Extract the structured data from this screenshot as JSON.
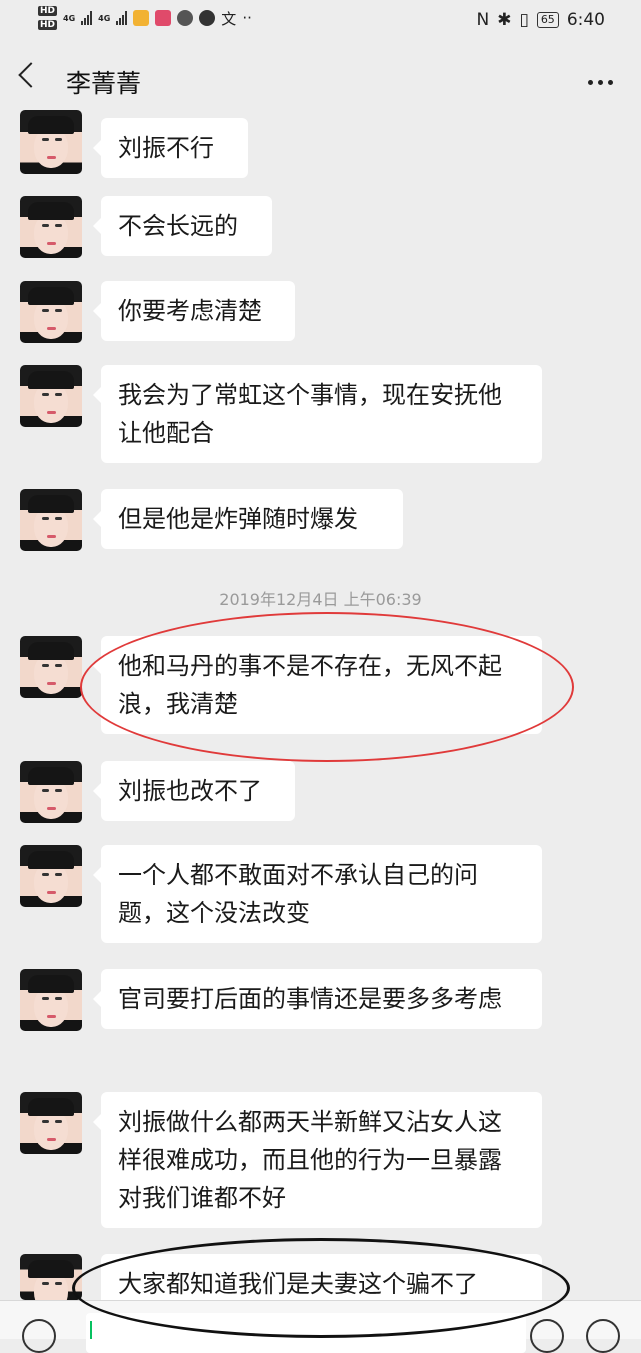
{
  "status_bar": {
    "hd1": "HD",
    "hd2": "HD",
    "net1": "4G",
    "net2": "4G",
    "misc_icon": "文",
    "dots": "··",
    "nfc": "N",
    "bluetooth": "✱",
    "vibrate": "▯",
    "battery": "65",
    "time": "6:40"
  },
  "header": {
    "title": "李菁菁"
  },
  "messages": [
    {
      "text": "刘振不行"
    },
    {
      "text": "不会长远的"
    },
    {
      "text": "你要考虑清楚"
    },
    {
      "text": "我会为了常虹这个事情，现在安抚他让他配合"
    },
    {
      "text": "但是他是炸弹随时爆发"
    },
    {
      "text": "他和马丹的事不是不存在，无风不起浪，我清楚"
    },
    {
      "text": "刘振也改不了"
    },
    {
      "text": "一个人都不敢面对不承认自己的问题，这个没法改变"
    },
    {
      "text": "官司要打后面的事情还是要多多考虑"
    },
    {
      "text": "刘振做什么都两天半新鲜又沾女人这样很难成功，而且他的行为一旦暴露对我们谁都不好"
    },
    {
      "text": "大家都知道我们是夫妻这个骗不了"
    }
  ],
  "timestamp": "2019年12月4日 上午06:39",
  "icons": {
    "back": "back-icon",
    "more": "more-icon",
    "voice": "voice-icon",
    "emoji": "emoji-icon",
    "plus": "plus-icon"
  },
  "colors": {
    "background": "#ededed",
    "bubble": "#ffffff",
    "highlight_red": "#e03a3a",
    "highlight_black": "#111111",
    "accent": "#07c160"
  }
}
